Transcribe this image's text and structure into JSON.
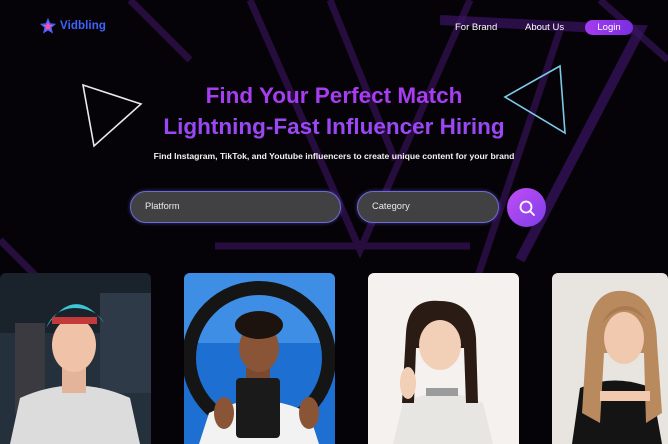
{
  "brand": {
    "name": "Vidbling"
  },
  "nav": {
    "for_brand": "For Brand",
    "about_us": "About Us",
    "login": "Login"
  },
  "hero": {
    "title_line1": "Find Your Perfect Match",
    "title_line2": "Lightning-Fast Influencer Hiring",
    "subtitle": "Find Instagram, TikTok, and Youtube influencers to create unique content for your brand"
  },
  "search": {
    "platform_placeholder": "Platform",
    "category_placeholder": "Category"
  },
  "icons": [
    "logo-star-icon",
    "search-icon",
    "triangle-outline-icon"
  ],
  "colors": {
    "accent": "#a63df0",
    "brand": "#3e63ff",
    "field_bg": "#414144",
    "background": "#050307"
  },
  "influencer_cards": [
    {
      "subject": "gamer-with-blue-hair"
    },
    {
      "subject": "creator-with-ring-light"
    },
    {
      "subject": "woman-smiling"
    },
    {
      "subject": "woman-posing"
    }
  ]
}
